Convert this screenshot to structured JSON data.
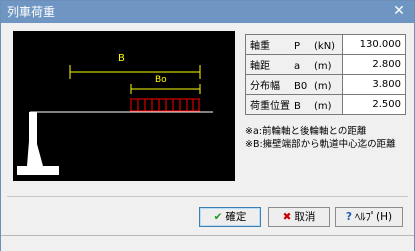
{
  "window": {
    "title": "列車荷重",
    "close_glyph": "✕"
  },
  "figure": {
    "label_b": "B",
    "label_bo": "Bo",
    "line_color": "#ffff00",
    "load_color": "#ff0000",
    "wall_color": "#ffffff"
  },
  "table": {
    "rows": [
      {
        "name": "軸重",
        "sym": "P",
        "unit": "(kN)",
        "value": "130.000"
      },
      {
        "name": "軸距",
        "sym": "a",
        "unit": "(m)",
        "value": "2.800"
      },
      {
        "name": "分布幅",
        "sym": "B0",
        "unit": "(m)",
        "value": "3.800"
      },
      {
        "name": "荷重位置",
        "sym": "B",
        "unit": "(m)",
        "value": "2.500"
      }
    ]
  },
  "notes": [
    "※a:前輪軸と後輪軸との距離",
    "※B:擁壁端部から軌道中心迄の距離"
  ],
  "buttons": {
    "ok": {
      "label": "確定",
      "icon": "check-icon"
    },
    "cancel": {
      "label": "取消",
      "icon": "x-icon"
    },
    "help": {
      "label": "ﾍﾙﾌﾟ(H)",
      "icon": "help-icon"
    }
  },
  "colors": {
    "title_bar": "#6f96c3",
    "ok_icon": "#1a9a1a",
    "cancel_icon": "#cc0000",
    "help_icon": "#1e5fb4"
  }
}
